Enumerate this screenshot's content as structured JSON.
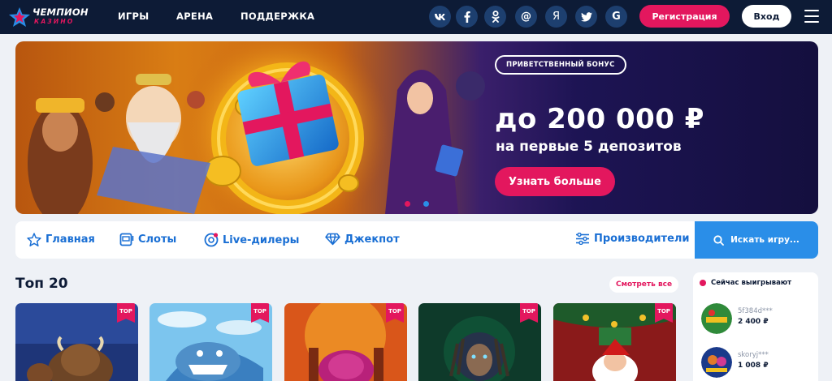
{
  "header": {
    "logo_line1": "ЧЕМПИОН",
    "logo_line2": "КАЗИНО",
    "nav": [
      "ИГРЫ",
      "АРЕНА",
      "ПОДДЕРЖКА"
    ],
    "social": [
      {
        "icon": "vk-icon",
        "glyph": "vk"
      },
      {
        "icon": "facebook-icon",
        "glyph": "f"
      },
      {
        "icon": "odnoklassniki-icon",
        "glyph": "ok"
      },
      {
        "icon": "mail-icon",
        "glyph": "@"
      },
      {
        "icon": "yandex-icon",
        "glyph": "Я"
      },
      {
        "icon": "twitter-icon",
        "glyph": "tw"
      },
      {
        "icon": "google-icon",
        "glyph": "G"
      }
    ],
    "register_label": "Регистрация",
    "login_label": "Вход"
  },
  "banner": {
    "badge": "ПРИВЕТСТВЕННЫЙ БОНУС",
    "amount": "до 200 000 ₽",
    "subtitle": "на первые 5 депозитов",
    "cta": "Узнать больше",
    "slides": 2,
    "active_slide": 1
  },
  "categories": {
    "items": [
      {
        "label": "Главная",
        "icon": "star-icon"
      },
      {
        "label": "Слоты",
        "icon": "slot-machine-icon"
      },
      {
        "label": "Live-дилеры",
        "icon": "live-dealer-icon"
      },
      {
        "label": "Джекпот",
        "icon": "diamond-icon"
      }
    ],
    "providers_label": "Производители",
    "search_label": "Искать игру..."
  },
  "top20": {
    "title": "Топ 20",
    "see_all": "Смотреть все",
    "badge": "TOP",
    "cards": [
      "bison-slot",
      "shark-slot",
      "buffalo-slot",
      "warrior-slot",
      "santa-slot"
    ]
  },
  "winners": {
    "title": "Сейчас выигрывают",
    "items": [
      {
        "name": "5f384d***",
        "amount": "2 400 ₽"
      },
      {
        "name": "skoryj***",
        "amount": "1 008 ₽"
      }
    ]
  },
  "colors": {
    "header_bg": "#0d1b36",
    "accent_pink": "#e3175e",
    "accent_blue": "#1a6fd4",
    "search_blue": "#2a8ee8",
    "page_bg": "#eef1f6"
  }
}
